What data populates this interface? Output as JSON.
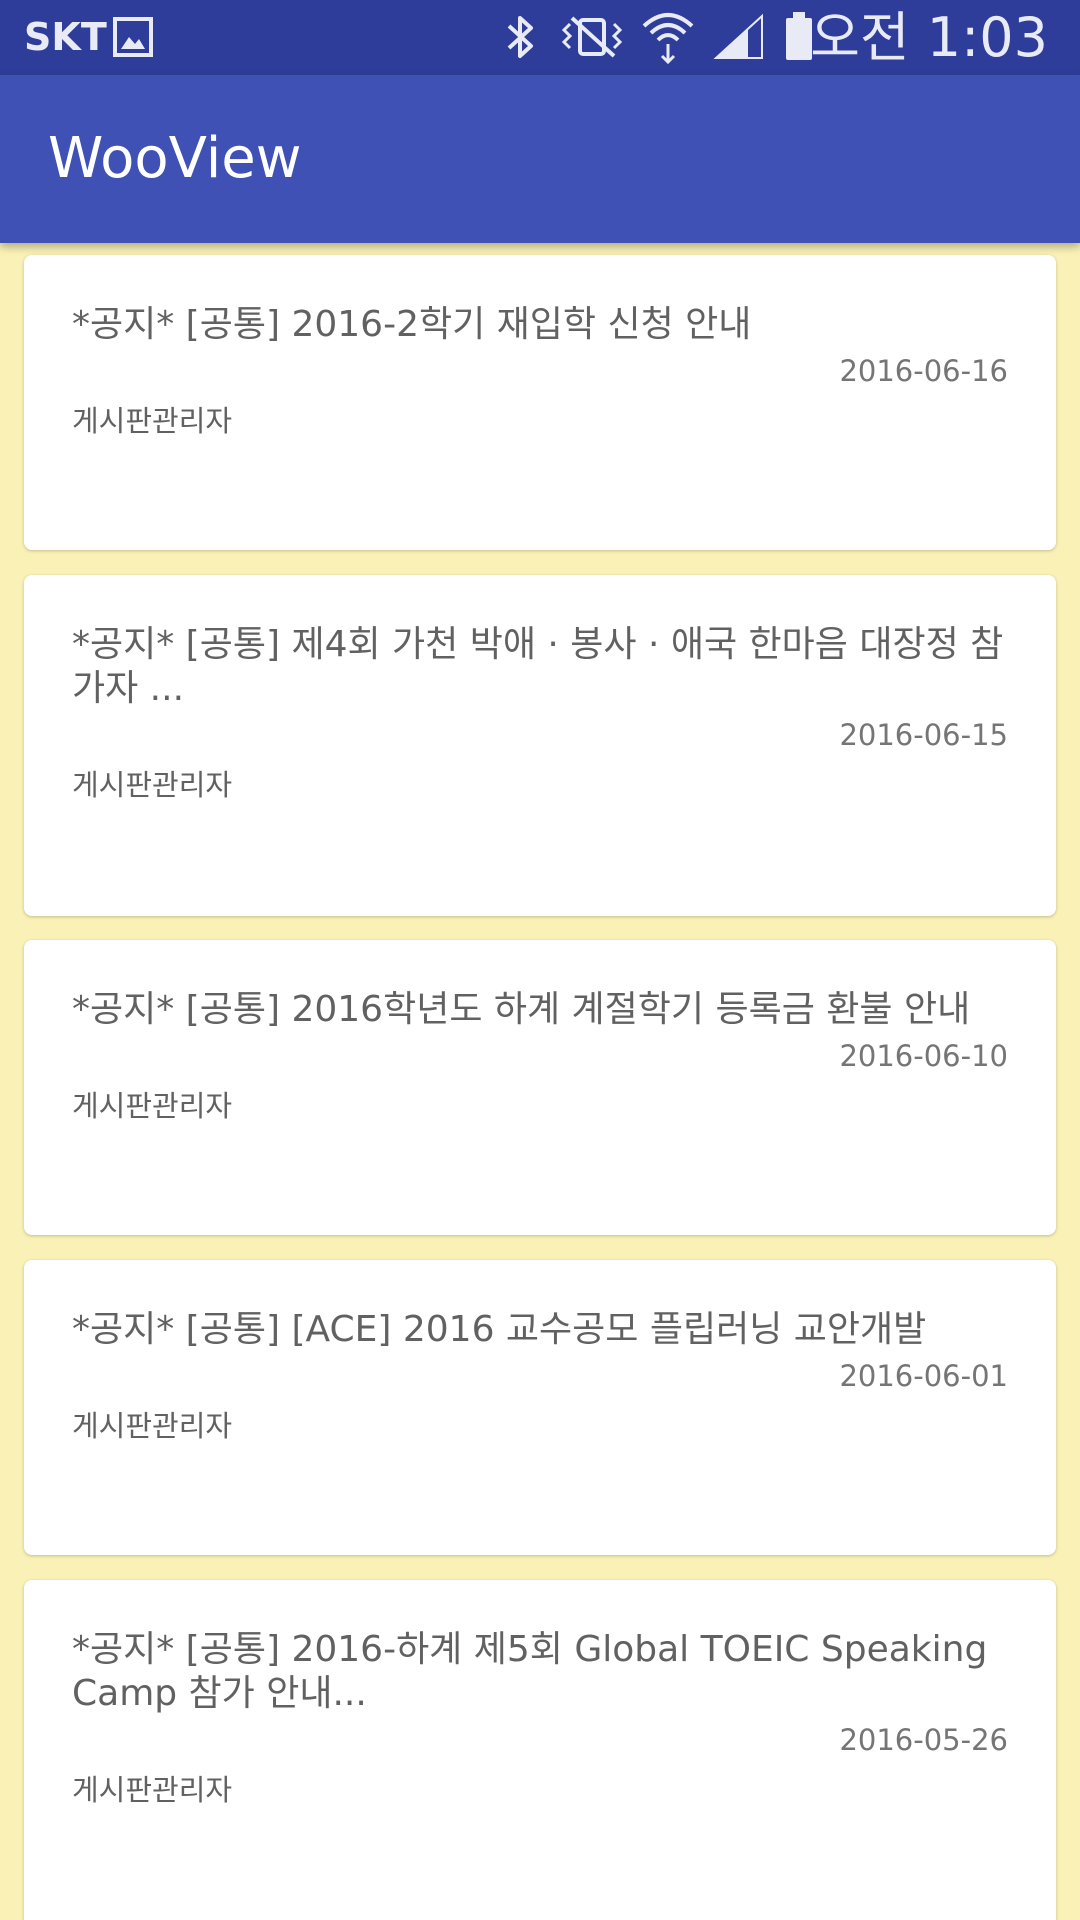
{
  "status_bar": {
    "carrier": "SKT",
    "time": "오전 1:03",
    "icons": [
      "gallery-icon",
      "bluetooth-icon",
      "vibrate-icon",
      "wifi-icon",
      "signal-icon",
      "battery-icon"
    ]
  },
  "app_bar": {
    "title": "WooView",
    "color": "#3f51b5",
    "status_color": "#2e3d99"
  },
  "background_color": "#f9f1b6",
  "notices": [
    {
      "title": "*공지* [공통] 2016-2학기 재입학 신청 안내",
      "date": "2016-06-16",
      "author": "게시판관리자"
    },
    {
      "title": "*공지* [공통] 제4회 가천 박애 · 봉사 · 애국 한마음 대장정 참가자 ...",
      "date": "2016-06-15",
      "author": "게시판관리자"
    },
    {
      "title": "*공지* [공통] 2016학년도 하계 계절학기 등록금 환불 안내",
      "date": "2016-06-10",
      "author": "게시판관리자"
    },
    {
      "title": "*공지* [공통] [ACE] 2016 교수공모 플립러닝 교안개발",
      "date": "2016-06-01",
      "author": "게시판관리자"
    },
    {
      "title": "*공지* [공통] 2016-하계 제5회 Global TOEIC Speaking Camp 참가 안내...",
      "date": "2016-05-26",
      "author": "게시판관리자"
    }
  ]
}
